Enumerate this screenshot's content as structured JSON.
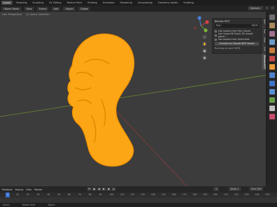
{
  "workspace_tabs": [
    "Layout",
    "Modeling",
    "Sculpting",
    "UV Editing",
    "Texture Paint",
    "Shading",
    "Animation",
    "Rendering",
    "Compositing",
    "Geometry Nodes",
    "Scripting"
  ],
  "viewport_header": {
    "mode": "Object Mode",
    "view": "View",
    "select": "Select",
    "add": "Add",
    "object": "Object",
    "orientation": "Global",
    "options": "Options"
  },
  "viewport_sub": {
    "left": "User Perspective",
    "right": "(1) Scene Collection"
  },
  "mcp_panel": {
    "title": "Blender MCP",
    "port_label": "Port:",
    "port_value": "9876",
    "checks": [
      "Use assets from Poly Haven",
      "Use Hyper3D Rodin 3D model gener...",
      "Use assets from Sketchfab"
    ],
    "connect_button": "Connect to Claude MCP server",
    "status": "Running on port 9876"
  },
  "side_tabs": [
    "Item",
    "Tool",
    "View",
    "Edit",
    "BlenderMCP"
  ],
  "timeline": {
    "menus": [
      "Playback",
      "Keying",
      "View",
      "Marker"
    ],
    "current_frame": "1",
    "start": "Start",
    "start_value": "1",
    "end": "End",
    "end_value": "250",
    "ruler": [
      "0",
      "10",
      "20",
      "30",
      "40",
      "50",
      "60",
      "70",
      "80",
      "90",
      "100",
      "110",
      "120",
      "130",
      "140",
      "150",
      "160",
      "170",
      "180",
      "190",
      "200",
      "210",
      "220",
      "230",
      "240",
      "250"
    ]
  },
  "status_bar": {
    "left": "Select",
    "middle": "Rotate View",
    "right": "Object"
  },
  "colors": {
    "model": "#ffa21a",
    "model_edge": "#e57800",
    "x_axis": "#8a3b3b",
    "y_axis": "#6b8a2f",
    "accent": "#3d72d6"
  }
}
